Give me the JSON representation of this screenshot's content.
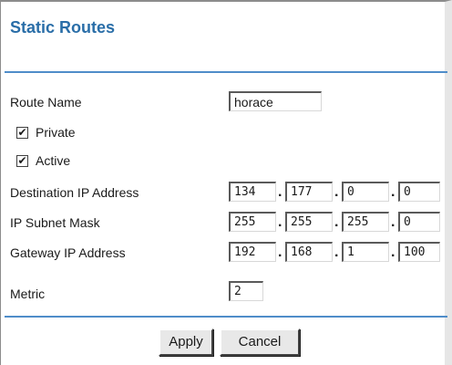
{
  "page": {
    "title": "Static Routes"
  },
  "form": {
    "route_name": {
      "label": "Route Name",
      "value": "horace"
    },
    "private": {
      "label": "Private",
      "checked": true,
      "mark": "✔"
    },
    "active": {
      "label": "Active",
      "checked": true,
      "mark": "✔"
    },
    "destination_ip": {
      "label": "Destination IP Address",
      "octets": [
        "134",
        "177",
        "0",
        "0"
      ]
    },
    "subnet_mask": {
      "label": "IP Subnet Mask",
      "octets": [
        "255",
        "255",
        "255",
        "0"
      ]
    },
    "gateway_ip": {
      "label": "Gateway IP Address",
      "octets": [
        "192",
        "168",
        "1",
        "100"
      ]
    },
    "metric": {
      "label": "Metric",
      "value": "2"
    },
    "separator": "."
  },
  "buttons": {
    "apply": "Apply",
    "cancel": "Cancel"
  },
  "colors": {
    "accent": "#4f8dc9",
    "title": "#2a6ea8"
  }
}
